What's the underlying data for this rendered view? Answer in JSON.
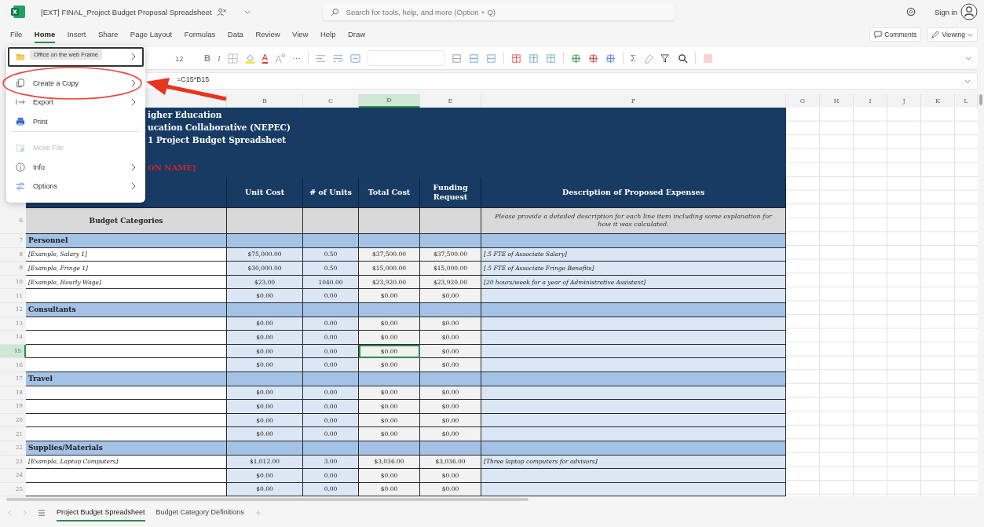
{
  "app": {
    "title": "[EXT] FINAL_Project Budget Proposal Spreadsheet",
    "search_placeholder": "Search for tools, help, and more (Option + Q)",
    "sign_in": "Sign in"
  },
  "menu_tabs": [
    {
      "label": "File",
      "selected": false
    },
    {
      "label": "Home",
      "selected": true
    },
    {
      "label": "Insert",
      "selected": false
    },
    {
      "label": "Share",
      "selected": false
    },
    {
      "label": "Page Layout",
      "selected": false
    },
    {
      "label": "Formulas",
      "selected": false
    },
    {
      "label": "Data",
      "selected": false
    },
    {
      "label": "Review",
      "selected": false
    },
    {
      "label": "View",
      "selected": false
    },
    {
      "label": "Help",
      "selected": false
    },
    {
      "label": "Draw",
      "selected": false
    }
  ],
  "actions": [
    "Comments",
    "Viewing"
  ],
  "ribbon": {
    "font_size": "12",
    "bold": "B",
    "italic": "I",
    "font_color": "A",
    "sum": "Σ",
    "more": "···"
  },
  "formula_bar": {
    "formula": "=C15*B15"
  },
  "file_menu": {
    "items": [
      {
        "kind": "open",
        "tooltip": "Office on the web Frame",
        "focused": true,
        "submenu": true,
        "disabled": false,
        "annotated": false,
        "divider_after": false
      },
      {
        "kind": "copy",
        "label": "Create a Copy",
        "focused": false,
        "submenu": true,
        "disabled": false,
        "annotated": true,
        "divider_after": false
      },
      {
        "kind": "export",
        "label": "Export",
        "focused": false,
        "submenu": true,
        "disabled": false,
        "annotated": false,
        "divider_after": false
      },
      {
        "kind": "print",
        "label": "Print",
        "focused": false,
        "submenu": false,
        "disabled": false,
        "annotated": false,
        "divider_after": true
      },
      {
        "kind": "move",
        "label": "Move File",
        "focused": false,
        "submenu": false,
        "disabled": true,
        "annotated": false,
        "divider_after": false
      },
      {
        "kind": "info",
        "label": "Info",
        "focused": false,
        "submenu": true,
        "disabled": false,
        "annotated": false,
        "divider_after": false
      },
      {
        "kind": "options",
        "label": "Options",
        "focused": false,
        "submenu": true,
        "disabled": false,
        "annotated": false,
        "divider_after": false
      }
    ]
  },
  "columns": [
    {
      "label": "B",
      "selected": false
    },
    {
      "label": "C",
      "selected": false
    },
    {
      "label": "D",
      "selected": true
    },
    {
      "label": "E",
      "selected": false
    },
    {
      "label": "F",
      "selected": false
    },
    {
      "label": "G",
      "selected": false
    },
    {
      "label": "H",
      "selected": false
    },
    {
      "label": "I",
      "selected": false
    },
    {
      "label": "J",
      "selected": false
    },
    {
      "label": "K",
      "selected": false
    },
    {
      "label": "L",
      "selected": false
    }
  ],
  "sheet_header": {
    "lines": [
      "igher Education",
      "ucation Collaborative (NEPEC)",
      "1 Project Budget Spreadsheet"
    ],
    "name_placeholder": "ON NAME]"
  },
  "table_headings": [
    "Unit Cost",
    "# of Units",
    "Total Cost",
    "Funding Request",
    "Description of Proposed Expenses"
  ],
  "subheader": {
    "num": "6",
    "label": "Budget Categories",
    "note": "Please provide a detailed description for each line item including some explanation for how it was calculated."
  },
  "rows": [
    {
      "num": "7",
      "kind": "category",
      "label": "Personnel",
      "selected": false
    },
    {
      "num": "8",
      "kind": "item",
      "label": "[Example, Salary 1]",
      "unit_cost": "$75,000.00",
      "units": "0.50",
      "total": "$37,500.00",
      "funding": "$37,500.00",
      "description": "[.5 FTE of Associate Salary]",
      "selected": false
    },
    {
      "num": "9",
      "kind": "item",
      "label": "[Example, Fringe 1]",
      "unit_cost": "$30,000.00",
      "units": "0.50",
      "total": "$15,000.00",
      "funding": "$15,000.00",
      "description": "[.5 FTE of Associate Fringe Benefits]",
      "selected": false
    },
    {
      "num": "10",
      "kind": "item",
      "label": "[Example, Hourly Wage]",
      "unit_cost": "$23.00",
      "units": "1040.00",
      "total": "$23,920.00",
      "funding": "$23,920.00",
      "description": "[20 hours/week for a year of Administrative Assistant]",
      "selected": false
    },
    {
      "num": "11",
      "kind": "item",
      "unit_cost": "$0.00",
      "units": "0.00",
      "total": "$0.00",
      "funding": "$0.00",
      "selected": false
    },
    {
      "num": "12",
      "kind": "category",
      "label": "Consultants",
      "selected": false
    },
    {
      "num": "13",
      "kind": "item",
      "unit_cost": "$0.00",
      "units": "0.00",
      "total": "$0.00",
      "funding": "$0.00",
      "selected": false
    },
    {
      "num": "14",
      "kind": "item",
      "unit_cost": "$0.00",
      "units": "0.00",
      "total": "$0.00",
      "funding": "$0.00",
      "selected": false
    },
    {
      "num": "15",
      "kind": "item",
      "unit_cost": "$0.00",
      "units": "0.00",
      "total": "$0.00",
      "funding": "$0.00",
      "selected": true
    },
    {
      "num": "16",
      "kind": "item",
      "unit_cost": "$0.00",
      "units": "0.00",
      "total": "$0.00",
      "funding": "$0.00",
      "selected": false
    },
    {
      "num": "17",
      "kind": "category",
      "label": "Travel",
      "selected": false
    },
    {
      "num": "18",
      "kind": "item",
      "unit_cost": "$0.00",
      "units": "0.00",
      "total": "$0.00",
      "funding": "$0.00",
      "selected": false
    },
    {
      "num": "19",
      "kind": "item",
      "unit_cost": "$0.00",
      "units": "0.00",
      "total": "$0.00",
      "funding": "$0.00",
      "selected": false
    },
    {
      "num": "20",
      "kind": "item",
      "unit_cost": "$0.00",
      "units": "0.00",
      "total": "$0.00",
      "funding": "$0.00",
      "selected": false
    },
    {
      "num": "21",
      "kind": "item",
      "unit_cost": "$0.00",
      "units": "0.00",
      "total": "$0.00",
      "funding": "$0.00",
      "selected": false
    },
    {
      "num": "22",
      "kind": "category",
      "label": "Supplies/Materials",
      "selected": false
    },
    {
      "num": "23",
      "kind": "item",
      "label": "[Example, Laptop Computers]",
      "unit_cost": "$1,012.00",
      "units": "3.00",
      "total": "$3,036.00",
      "funding": "$3,036.00",
      "description": "[Three laptop computers for advisors]",
      "selected": false
    },
    {
      "num": "24",
      "kind": "item",
      "unit_cost": "$0.00",
      "units": "0.00",
      "total": "$0.00",
      "funding": "$0.00",
      "selected": false
    },
    {
      "num": "25",
      "kind": "item",
      "unit_cost": "$0.00",
      "units": "0.00",
      "total": "$0.00",
      "funding": "$0.00",
      "selected": false
    }
  ],
  "sheet_tabs": [
    {
      "label": "Project Budget Spreadsheet",
      "selected": true
    },
    {
      "label": "Budget Category Definitions",
      "selected": false
    }
  ]
}
